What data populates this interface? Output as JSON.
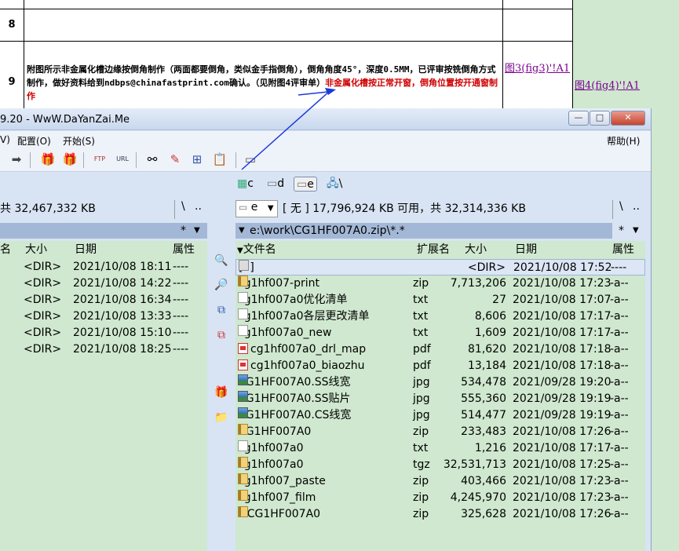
{
  "sheet": {
    "row8_num": "8",
    "row9_num": "9",
    "desc_black": "附图所示非金属化槽边缘按倒角制作（两面都要倒角，类似金手指倒角），倒角角度45°，深度0.5MM，已评审按铣倒角方式制作，做好资料给到ndbps@chinafastprint.com确认。（见附图4评审单）",
    "desc_red": "非金属化槽按正常开窗，倒角位置按开通窗制作",
    "link1": "图3(fig3)'!A1",
    "link2": "图4(fig4)'!A1"
  },
  "window": {
    "title": "9.20 - WwW.DaYanZai.Me",
    "minimize": "—",
    "maximize": "□",
    "close": "✕"
  },
  "menu": {
    "item1": "V)",
    "item2": "配置(O)",
    "item3": "开始(S)",
    "help": "帮助(H)"
  },
  "toolbar_icons": [
    "arrow-right-icon",
    "gift-icon",
    "gift-icon",
    "ftp-icon",
    "url-icon",
    "binoculars-icon",
    "pen-icon",
    "tree-icon",
    "clipboard-icon",
    "edit-icon"
  ],
  "drives": {
    "c": "c",
    "d": "d",
    "e": "e",
    "net": "\\"
  },
  "left": {
    "space_text": "共 32,467,332 KB",
    "root": "\\",
    "up": "..",
    "filter": "*",
    "headers": {
      "name": "名",
      "size": "大小",
      "date": "日期",
      "attr": "属性"
    },
    "files": [
      {
        "size": "<DIR>",
        "date": "2021/10/08 18:11",
        "attr": "----"
      },
      {
        "size": "<DIR>",
        "date": "2021/10/08 14:22",
        "attr": "----"
      },
      {
        "size": "<DIR>",
        "date": "2021/10/08 16:34",
        "attr": "----"
      },
      {
        "size": "<DIR>",
        "date": "2021/10/08 13:33",
        "attr": "----"
      },
      {
        "size": "<DIR>",
        "date": "2021/10/08 15:10",
        "attr": "----"
      },
      {
        "size": "<DIR>",
        "date": "2021/10/08 18:25",
        "attr": "----"
      }
    ]
  },
  "right": {
    "drive_label": "e",
    "space_text": "[ 无 ]  17,796,924 KB 可用，共 32,314,336 KB",
    "root": "\\",
    "up": "..",
    "path": "e:\\work\\CG1HF007A0.zip\\*.*",
    "filter": "*",
    "headers": {
      "name": "文件名",
      "ext": "扩展名",
      "size": "大小",
      "date": "日期",
      "attr": "属性"
    },
    "files": [
      {
        "icon": "up",
        "name": "[..]",
        "ext": "",
        "size": "<DIR>",
        "date": "2021/10/08 17:52",
        "attr": "----"
      },
      {
        "icon": "folder",
        "name": "cg1hf007-print",
        "ext": "zip",
        "size": "7,713,206",
        "date": "2021/10/08 17:23",
        "attr": "-a--"
      },
      {
        "icon": "txt",
        "name": "cg1hf007a0优化清单",
        "ext": "txt",
        "size": "27",
        "date": "2021/10/08 17:07",
        "attr": "-a--"
      },
      {
        "icon": "txt",
        "name": "cg1hf007a0各层更改清单",
        "ext": "txt",
        "size": "8,606",
        "date": "2021/10/08 17:17",
        "attr": "-a--"
      },
      {
        "icon": "txt",
        "name": "cg1hf007a0_new",
        "ext": "txt",
        "size": "1,609",
        "date": "2021/10/08 17:17",
        "attr": "-a--"
      },
      {
        "icon": "pdf",
        "name": "cg1hf007a0_drl_map",
        "ext": "pdf",
        "size": "81,620",
        "date": "2021/10/08 17:18",
        "attr": "-a--"
      },
      {
        "icon": "pdf",
        "name": "cg1hf007a0_biaozhu",
        "ext": "pdf",
        "size": "13,184",
        "date": "2021/10/08 17:18",
        "attr": "-a--"
      },
      {
        "icon": "jpg",
        "name": "CG1HF007A0.SS线宽",
        "ext": "jpg",
        "size": "534,478",
        "date": "2021/09/28 19:20",
        "attr": "-a--"
      },
      {
        "icon": "jpg",
        "name": "CG1HF007A0.SS贴片",
        "ext": "jpg",
        "size": "555,360",
        "date": "2021/09/28 19:19",
        "attr": "-a--"
      },
      {
        "icon": "jpg",
        "name": "CG1HF007A0.CS线宽",
        "ext": "jpg",
        "size": "514,477",
        "date": "2021/09/28 19:19",
        "attr": "-a--"
      },
      {
        "icon": "folder",
        "name": "CG1HF007A0",
        "ext": "zip",
        "size": "233,483",
        "date": "2021/10/08 17:26",
        "attr": "-a--"
      },
      {
        "icon": "txt",
        "name": "cg1hf007a0",
        "ext": "txt",
        "size": "1,216",
        "date": "2021/10/08 17:17",
        "attr": "-a--"
      },
      {
        "icon": "folder",
        "name": "cg1hf007a0",
        "ext": "tgz",
        "size": "32,531,713",
        "date": "2021/10/08 17:25",
        "attr": "-a--"
      },
      {
        "icon": "folder",
        "name": "cg1hf007_paste",
        "ext": "zip",
        "size": "403,466",
        "date": "2021/10/08 17:23",
        "attr": "-a--"
      },
      {
        "icon": "folder",
        "name": "cg1hf007_film",
        "ext": "zip",
        "size": "4,245,970",
        "date": "2021/10/08 17:23",
        "attr": "-a--"
      },
      {
        "icon": "folder",
        "name": "#CG1HF007A0",
        "ext": "zip",
        "size": "325,628",
        "date": "2021/10/08 17:26",
        "attr": "-a--"
      }
    ]
  },
  "colors": {
    "panel_bg": "#cfe8cf",
    "chrome_bg": "#d8e4f3",
    "path_bg": "#a3b8d6",
    "red_text": "#d00000",
    "link": "#7a0090"
  }
}
